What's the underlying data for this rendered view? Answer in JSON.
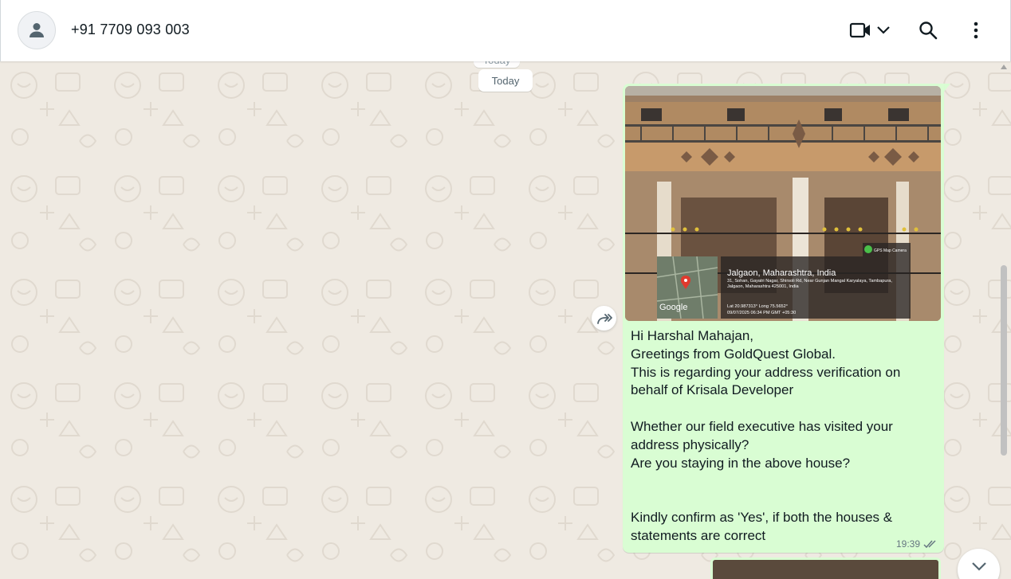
{
  "header": {
    "contact_name": "+91 7709 093 003",
    "icons": [
      "default-avatar-icon",
      "video-call-icon",
      "chevron-down-icon",
      "search-icon",
      "menu-icon"
    ]
  },
  "chat": {
    "date_chip_ghost": "Today",
    "date_chip": "Today",
    "message": {
      "photo_overlay": {
        "brand": "Google",
        "app": "GPS Map Camera",
        "place": "Jalgaon, Maharashtra, India",
        "address": "31, Sohan, Gayatri Nagar, Shirsoli Rd, Near Gunjan Mangal Karyalaya, Tambapura, Jalgaon, Maharashtra 425001, India",
        "coords": "Lat 20.987313° Long 75.5652°",
        "timestamp": "09/07/2025 06:34 PM GMT +05:30"
      },
      "lines": [
        "Hi Harshal Mahajan,",
        "Greetings from GoldQuest Global.",
        "This is regarding your address verification on behalf of Krisala Developer",
        "",
        "Whether our field executive has visited your address physically?",
        "Are you staying in the above house?",
        "",
        "",
        "Kindly confirm as 'Yes', if both the houses & statements are correct"
      ],
      "time": "19:39",
      "status": "read"
    }
  },
  "colors": {
    "bubble_out": "#d9fdd3",
    "chat_bg": "#efeae2",
    "read_tick": "#667781"
  }
}
